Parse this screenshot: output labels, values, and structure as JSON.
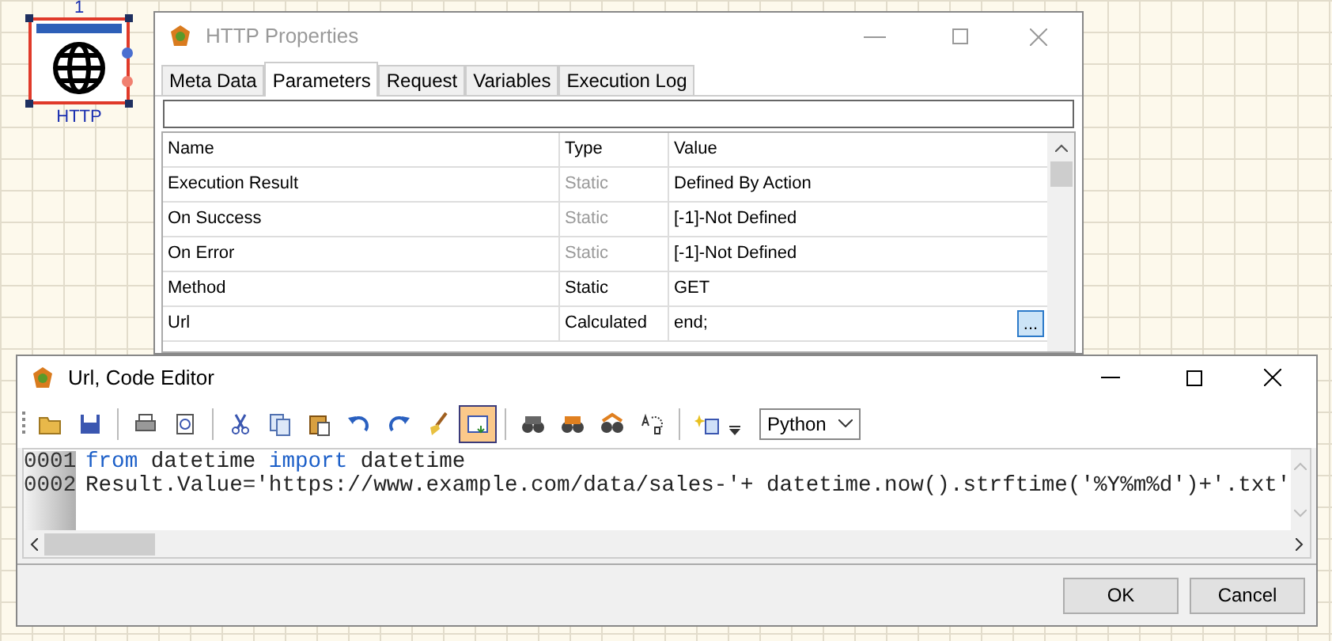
{
  "node": {
    "number": "1",
    "label": "HTTP",
    "selected": true
  },
  "properties_window": {
    "title": "HTTP Properties",
    "tabs": [
      {
        "label": "Meta Data",
        "selected": false
      },
      {
        "label": "Parameters",
        "selected": true
      },
      {
        "label": "Request",
        "selected": false
      },
      {
        "label": "Variables",
        "selected": false
      },
      {
        "label": "Execution Log",
        "selected": false
      }
    ],
    "table": {
      "columns": [
        "Name",
        "Type",
        "Value"
      ],
      "rows": [
        {
          "name": "Execution Result",
          "type": "Static",
          "value": "Defined By Action",
          "dimmed": true,
          "has_button": false
        },
        {
          "name": "On Success",
          "type": "Static",
          "value": "[-1]-Not Defined",
          "dimmed": true,
          "has_button": false
        },
        {
          "name": "On Error",
          "type": "Static",
          "value": "[-1]-Not Defined",
          "dimmed": true,
          "has_button": false
        },
        {
          "name": "Method",
          "type": "Static",
          "value": "GET",
          "dimmed": false,
          "has_button": false
        },
        {
          "name": "Url",
          "type": "Calculated",
          "value": "end;",
          "dimmed": false,
          "has_button": true,
          "button_label": "..."
        }
      ]
    }
  },
  "editor_window": {
    "title": "Url, Code Editor",
    "toolbar": [
      {
        "selected": false
      },
      {
        "selected": false
      },
      {
        "selected": false
      },
      {
        "selected": false
      },
      {
        "selected": false
      },
      {
        "selected": false
      },
      {
        "selected": false
      },
      {
        "selected": false
      },
      {
        "selected": false
      },
      {
        "selected": false
      },
      {
        "selected": true
      },
      {
        "selected": false
      },
      {
        "selected": false
      },
      {
        "selected": false
      },
      {
        "selected": false
      },
      {
        "selected": false
      }
    ],
    "language": "Python",
    "lines": [
      {
        "number": "0001",
        "tokens": [
          {
            "kind": "keyword",
            "text": "from"
          },
          {
            "kind": "text",
            "text": " datetime "
          },
          {
            "kind": "keyword",
            "text": "import"
          },
          {
            "kind": "text",
            "text": " datetime"
          }
        ]
      },
      {
        "number": "0002",
        "tokens": [
          {
            "kind": "text",
            "text": "Result.Value='https://www.example.com/data/sales-'+ datetime.now().strftime('%Y%m%d')+'.txt'"
          }
        ]
      }
    ],
    "buttons": [
      "OK",
      "Cancel"
    ]
  }
}
